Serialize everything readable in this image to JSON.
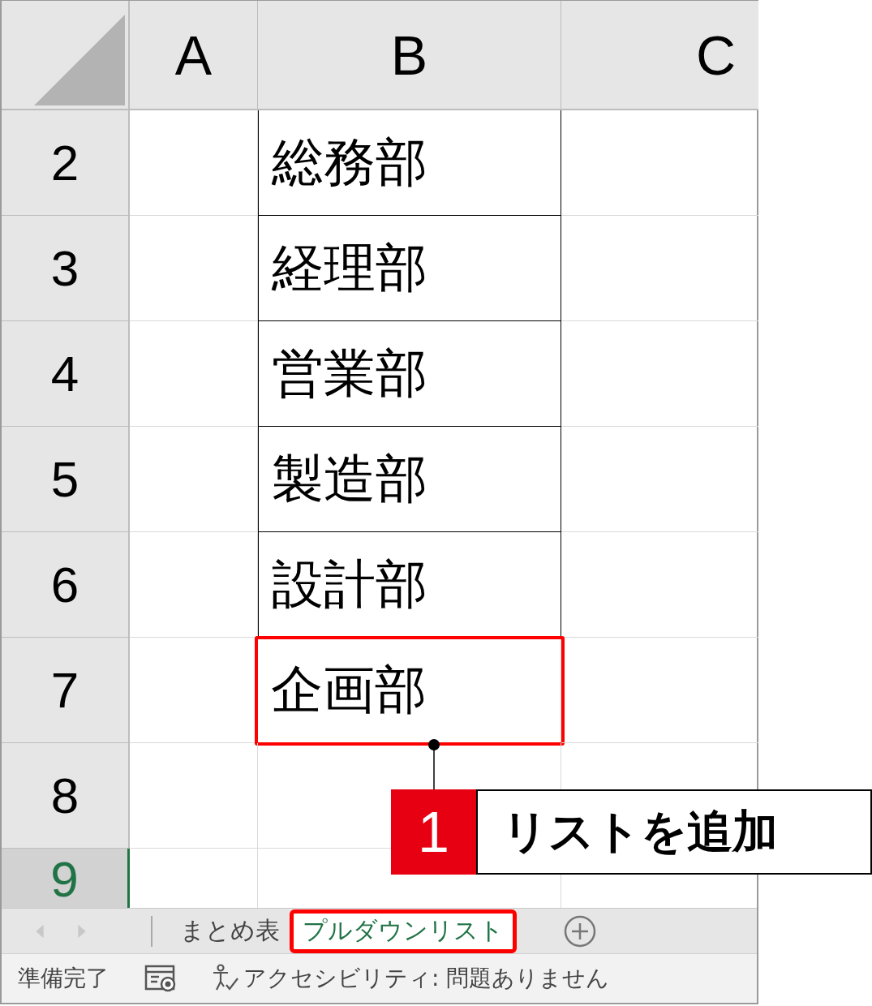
{
  "columns": [
    "A",
    "B",
    "C"
  ],
  "rows": [
    {
      "number": "2",
      "value": "総務部",
      "bordered": true,
      "highlighted": false,
      "active": false
    },
    {
      "number": "3",
      "value": "経理部",
      "bordered": true,
      "highlighted": false,
      "active": false
    },
    {
      "number": "4",
      "value": "営業部",
      "bordered": true,
      "highlighted": false,
      "active": false
    },
    {
      "number": "5",
      "value": "製造部",
      "bordered": true,
      "highlighted": false,
      "active": false
    },
    {
      "number": "6",
      "value": "設計部",
      "bordered": true,
      "highlighted": false,
      "active": false
    },
    {
      "number": "7",
      "value": "企画部",
      "bordered": false,
      "highlighted": true,
      "active": false
    },
    {
      "number": "8",
      "bordered": false,
      "highlighted": false,
      "active": false
    },
    {
      "number": "9",
      "bordered": false,
      "highlighted": false,
      "active": true
    }
  ],
  "callout": {
    "number": "1",
    "text": "リストを追加"
  },
  "sheet_tabs": [
    {
      "label": "まとめ表",
      "selected": false,
      "highlighted": false
    },
    {
      "label": "プルダウンリスト",
      "selected": true,
      "highlighted": true
    }
  ],
  "status_bar": {
    "ready": "準備完了",
    "accessibility": "アクセシビリティ: 問題ありません"
  }
}
